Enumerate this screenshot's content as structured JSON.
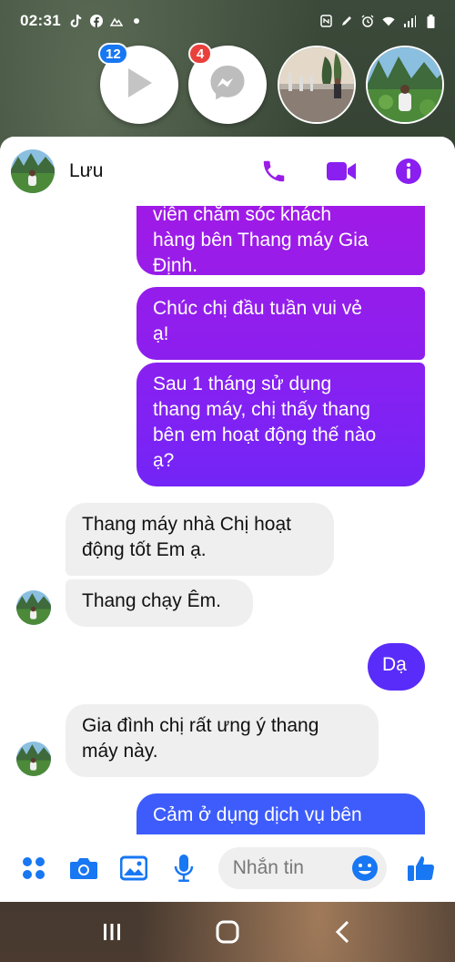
{
  "status_bar": {
    "time": "02:31",
    "left_icons": [
      "tiktok-icon",
      "facebook-icon",
      "mountain-icon",
      "dot-icon"
    ],
    "right_icons": [
      "nfc-icon",
      "pen-icon",
      "alarm-icon",
      "wifi-icon",
      "signal-icon",
      "battery-icon"
    ]
  },
  "chat_heads": [
    {
      "icon": "play-icon",
      "badge": "12"
    },
    {
      "icon": "messenger-icon",
      "badge": "4"
    },
    {
      "icon": "photo-fountain"
    },
    {
      "icon": "photo-lotus-person"
    }
  ],
  "header": {
    "contact_name": "Lưu",
    "actions": [
      "phone-icon",
      "video-icon",
      "info-icon"
    ]
  },
  "messages": [
    {
      "direction": "out",
      "lines": [
        "viên chăm sóc khách",
        "hàng bên Thang máy Gia",
        "Định."
      ]
    },
    {
      "direction": "out",
      "lines": [
        "Chúc chị đầu tuần vui vẻ",
        "ạ!"
      ]
    },
    {
      "direction": "out",
      "lines": [
        "Sau 1 tháng sử dụng",
        "thang máy, chị thấy thang",
        "bên em hoạt động thế nào",
        "ạ?"
      ]
    },
    {
      "direction": "in",
      "lines": [
        "Thang máy nhà Chị hoạt",
        "động tốt Em ạ."
      ]
    },
    {
      "direction": "in",
      "lines": [
        "Thang chạy Êm."
      ]
    },
    {
      "direction": "out",
      "lines": [
        "Dạ"
      ]
    },
    {
      "direction": "in",
      "lines": [
        "Gia đình chị rất ưng ý thang",
        "máy này."
      ]
    },
    {
      "direction": "out",
      "lines": [
        "Cảm ở dụng dịch vụ bên"
      ]
    }
  ],
  "composer": {
    "placeholder": "Nhắn tin",
    "icons": [
      "apps-icon",
      "camera-icon",
      "image-icon",
      "mic-icon",
      "emoji-icon",
      "thumbs-up-icon"
    ]
  },
  "nav_bar": [
    "recents-icon",
    "home-icon",
    "back-icon"
  ],
  "colors": {
    "accent": "#8a1ff0",
    "messenger_blue": "#1877f2",
    "incoming_bubble": "#efefef"
  }
}
